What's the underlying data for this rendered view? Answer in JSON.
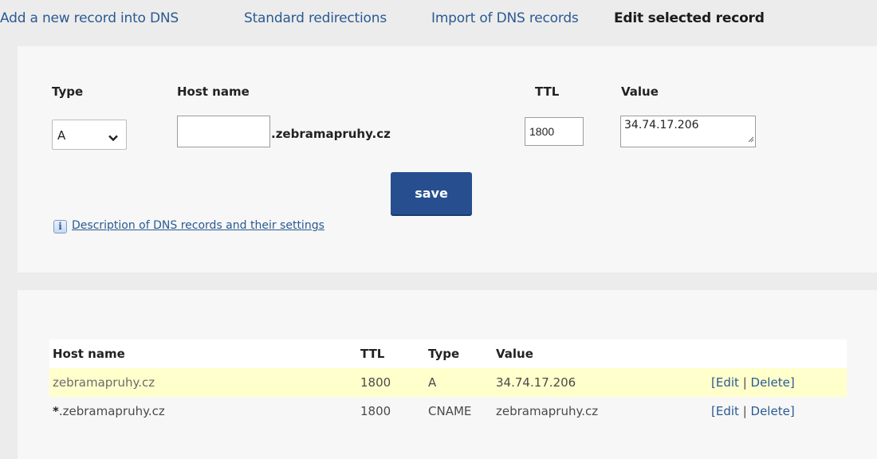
{
  "tabs": [
    {
      "label": "Add a new record into DNS"
    },
    {
      "label": "Standard redirections"
    },
    {
      "label": "Import of DNS records"
    },
    {
      "label": "Edit selected record"
    }
  ],
  "form": {
    "type_label": "Type",
    "host_label": "Host name",
    "ttl_label": "TTL",
    "value_label": "Value",
    "type_selected": "A",
    "host_value": "",
    "domain_suffix": ".zebramapruhy.cz",
    "ttl_value": "1800",
    "value_value": "34.74.17.206",
    "save_label": "save",
    "desc_link": "Description of DNS records and their settings",
    "info_glyph": "i"
  },
  "table": {
    "headers": [
      "Host name",
      "TTL",
      "Type",
      "Value"
    ],
    "rows": [
      {
        "host": "zebramapruhy.cz",
        "ttl": "1800",
        "type": "A",
        "value": "34.74.17.206",
        "highlighted": true
      },
      {
        "host_star": "*",
        "host": ".zebramapruhy.cz",
        "ttl": "1800",
        "type": "CNAME",
        "value": "zebramapruhy.cz",
        "highlighted": false
      }
    ],
    "actions": {
      "open": "[",
      "edit": "Edit",
      "sep": " | ",
      "delete": "Delete",
      "close": "]"
    }
  },
  "colors": {
    "accent": "#274f8f",
    "link": "#2a5a92",
    "highlight_row": "#ffffcc",
    "page_bg": "#ececec",
    "panel_bg": "#f7f7f7"
  },
  "icons": [
    "chevron-down-icon",
    "info-icon",
    "resize-grip-icon"
  ]
}
